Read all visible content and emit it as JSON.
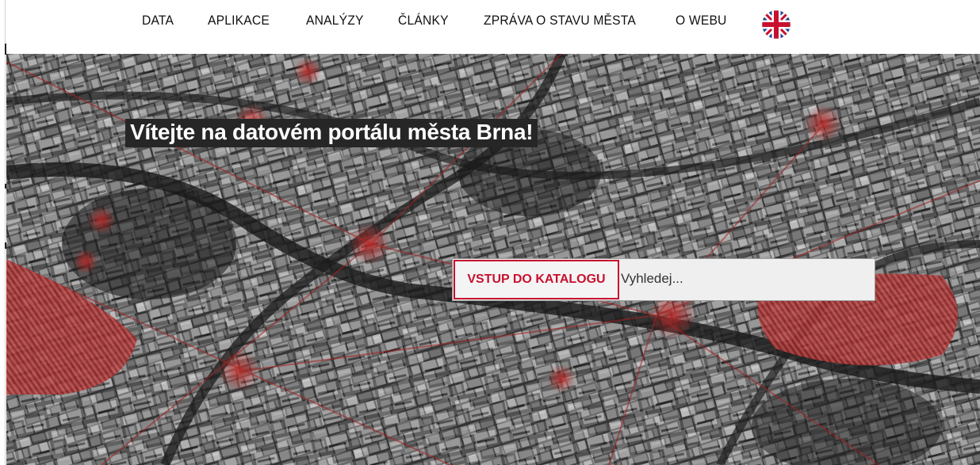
{
  "nav": {
    "items": [
      {
        "label": "DATA"
      },
      {
        "label": "APLIKACE"
      },
      {
        "label": "ANALÝZY"
      },
      {
        "label": "ČLÁNKY"
      },
      {
        "label": "ZPRÁVA O STAVU MĚSTA"
      },
      {
        "label": "O WEBU"
      }
    ],
    "language_icon": "uk-flag-icon"
  },
  "hero": {
    "title": "Vítejte na datovém portálu města Brna!",
    "background": "aerial-city-photo"
  },
  "search": {
    "catalog_button": "VSTUP DO KATALOGU",
    "placeholder": "Vyhledej..."
  },
  "colors": {
    "accent": "#c8102e",
    "nav_text": "#111111",
    "title_bg": "#262626"
  }
}
